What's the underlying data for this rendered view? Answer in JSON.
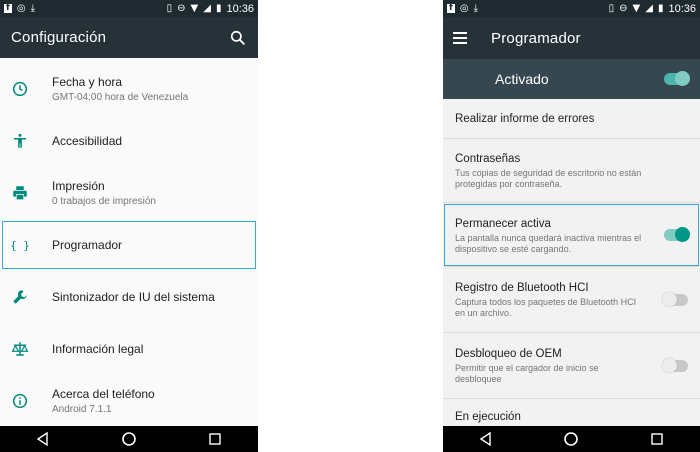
{
  "left_phone": {
    "status_bar": {
      "left_icons": [
        "facebook-icon",
        "whatsapp-icon",
        "download-icon"
      ],
      "right_icons": [
        "vibrate-icon",
        "do-not-disturb-icon",
        "wifi-icon",
        "signal-icon",
        "battery-icon"
      ],
      "time": "10:36"
    },
    "app_bar": {
      "title": "Configuración",
      "search_icon": "search-icon"
    },
    "items": [
      {
        "icon": "clock-icon",
        "title": "Fecha y hora",
        "subtitle": "GMT-04:00 hora de Venezuela"
      },
      {
        "icon": "accessibility-icon",
        "title": "Accesibilidad",
        "subtitle": ""
      },
      {
        "icon": "printer-icon",
        "title": "Impresión",
        "subtitle": "0 trabajos de impresión"
      },
      {
        "icon": "braces-icon",
        "title": "Programador",
        "subtitle": "",
        "highlighted": true
      },
      {
        "icon": "wrench-icon",
        "title": "Sintonizador de IU del sistema",
        "subtitle": ""
      },
      {
        "icon": "scales-icon",
        "title": "Información legal",
        "subtitle": ""
      },
      {
        "icon": "info-icon",
        "title": "Acerca del teléfono",
        "subtitle": "Android 7.1.1"
      }
    ],
    "nav_bar": [
      "back-icon",
      "home-icon",
      "recents-icon"
    ]
  },
  "right_phone": {
    "status_bar": {
      "left_icons": [
        "facebook-icon",
        "whatsapp-icon",
        "download-icon"
      ],
      "right_icons": [
        "vibrate-icon",
        "do-not-disturb-icon",
        "wifi-icon",
        "signal-icon",
        "battery-icon"
      ],
      "time": "10:36"
    },
    "app_bar": {
      "title": "Programador",
      "menu_icon": "hamburger-icon"
    },
    "master_switch": {
      "label": "Activado",
      "on": true
    },
    "settings": [
      {
        "title": "Realizar informe de errores",
        "subtitle": "",
        "toggle": null
      },
      {
        "title": "Contraseñas",
        "subtitle": "Tus copias de seguridad de escritorio no están protegidas por contraseña.",
        "toggle": null
      },
      {
        "title": "Permanecer activa",
        "subtitle": "La pantalla nunca quedará inactiva mientras el dispositivo se esté cargando.",
        "toggle": true,
        "highlighted": true
      },
      {
        "title": "Registro de Bluetooth HCI",
        "subtitle": "Captura todos los paquetes de Bluetooth HCI en un archivo.",
        "toggle": false
      },
      {
        "title": "Desbloqueo de OEM",
        "subtitle": "Permitir que el cargador de inicio se desbloquee",
        "toggle": false
      },
      {
        "title": "En ejecución",
        "subtitle": "",
        "toggle": null
      }
    ],
    "nav_bar": [
      "back-icon",
      "home-icon",
      "recents-icon"
    ]
  },
  "colors": {
    "status_bar": "#1f2a30",
    "app_bar": "#263238",
    "master_bar": "#37474f",
    "accent": "#009688",
    "icon_teal": "#00897b",
    "highlight_border": "#38a6d6"
  }
}
